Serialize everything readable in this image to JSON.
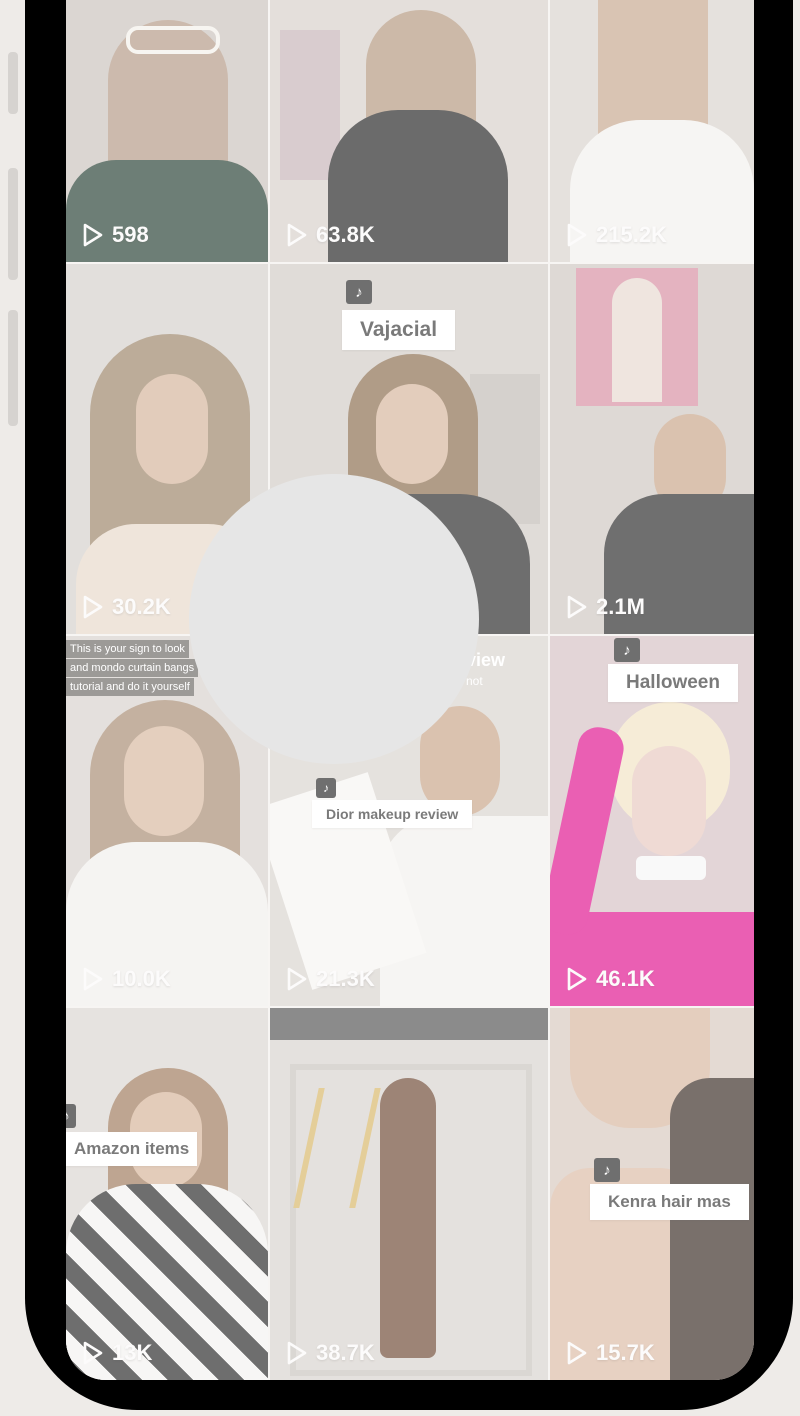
{
  "grid": {
    "tiles": [
      {
        "views": "598",
        "label": "",
        "bg": "#cbc3bd",
        "shirt": "#294235"
      },
      {
        "views": "63.8K",
        "label": "",
        "bg": "#d7d0cb",
        "shirt": "#262626"
      },
      {
        "views": "215.2K",
        "label": "",
        "bg": "#d9d3cd",
        "shirt": "#f2f0ed"
      },
      {
        "views": "30.2K",
        "label": "",
        "bg": "#d5d0cc",
        "shirt": "#e7d9cb"
      },
      {
        "views": "",
        "label": "Vajacial",
        "bg": "#d2ccc6",
        "shirt": "#2a2a2a"
      },
      {
        "views": "2.1M",
        "label": "",
        "bg": "#cfc8c2",
        "shirt": "#2b2b2b"
      },
      {
        "views": "10.0K",
        "label": "",
        "bg": "#d8d2cd",
        "shirt": "#f1efec",
        "caption": [
          "This is your sign to look",
          "and mondo curtain bangs",
          "tutorial and do it yourself"
        ]
      },
      {
        "views": "21.3K",
        "label": "Dior makeup review",
        "bg": "#d9d4cf",
        "shirt": "#f2f0ed",
        "caption_partial": "view",
        "caption_partial_2": "not"
      },
      {
        "views": "46.1K",
        "label": "Halloween",
        "bg": "#d6c2c4",
        "shirt": "#e1148f"
      },
      {
        "views": "13K",
        "label": "Amazon items",
        "bg": "#dbd6d1",
        "shirt": "#2a2a2a"
      },
      {
        "views": "38.7K",
        "label": "",
        "bg": "#d8d3ce",
        "shirt": "#6f4a36"
      },
      {
        "views": "15.7K",
        "label": "Kenra hair mas",
        "bg": "#d8c9bf",
        "shirt": "#3a2d26"
      }
    ]
  },
  "icons": {
    "play": "play-icon",
    "tiktok": "tiktok-icon"
  },
  "colors": {
    "frame": "#000000",
    "background": "#eeebe8",
    "overlay_circle": "#e6e6e6"
  }
}
